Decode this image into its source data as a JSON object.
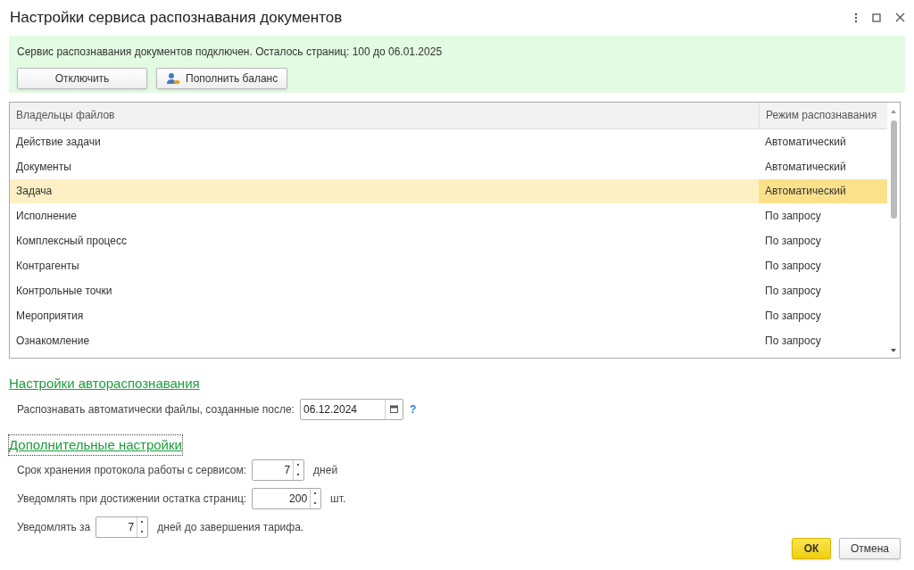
{
  "window": {
    "title": "Настройки сервиса распознавания документов"
  },
  "status_panel": {
    "message": "Сервис распознавания документов подключен. Осталось страниц: 100 до 06.01.2025",
    "buttons": [
      {
        "label": "Отключить",
        "kind": "plain"
      },
      {
        "label": "Пополнить баланс",
        "kind": "icon"
      }
    ]
  },
  "table": {
    "columns": [
      "Владельцы файлов",
      "Режим распознавания"
    ],
    "rows": [
      {
        "cells": [
          "Действие задачи",
          "Автоматический"
        ],
        "selected": false
      },
      {
        "cells": [
          "Документы",
          "Автоматический"
        ],
        "selected": false
      },
      {
        "cells": [
          "Задача",
          "Автоматический"
        ],
        "selected": true
      },
      {
        "cells": [
          "Исполнение",
          "По запросу"
        ],
        "selected": false
      },
      {
        "cells": [
          "Комплексный процесс",
          "По запросу"
        ],
        "selected": false
      },
      {
        "cells": [
          "Контрагенты",
          "По запросу"
        ],
        "selected": false
      },
      {
        "cells": [
          "Контрольные точки",
          "По запросу"
        ],
        "selected": false
      },
      {
        "cells": [
          "Мероприятия",
          "По запросу"
        ],
        "selected": false
      },
      {
        "cells": [
          "Ознакомление",
          "По запросу"
        ],
        "selected": false
      }
    ]
  },
  "sections": [
    {
      "title": "Настройки автораспознавания",
      "focused": false,
      "fields": [
        {
          "kind": "date",
          "label": "Распознавать автоматически файлы, созданные после:",
          "value": "06.12.2024",
          "help": "?"
        }
      ]
    },
    {
      "title": "Дополнительные настройки",
      "focused": true,
      "fields": [
        {
          "kind": "number",
          "label": "Срок хранения протокола работы с сервисом:",
          "value": "7",
          "unit": "дней"
        },
        {
          "kind": "number",
          "label": "Уведомлять при достижении остатка страниц:",
          "value": "200",
          "unit": "шт."
        },
        {
          "kind": "number",
          "label": "Уведомлять за",
          "value": "7",
          "unit": "дней до завершения тарифа."
        }
      ]
    }
  ],
  "footer": {
    "buttons": [
      {
        "label": "ОК",
        "kind": "default"
      },
      {
        "label": "Отмена",
        "kind": "plain"
      }
    ]
  }
}
